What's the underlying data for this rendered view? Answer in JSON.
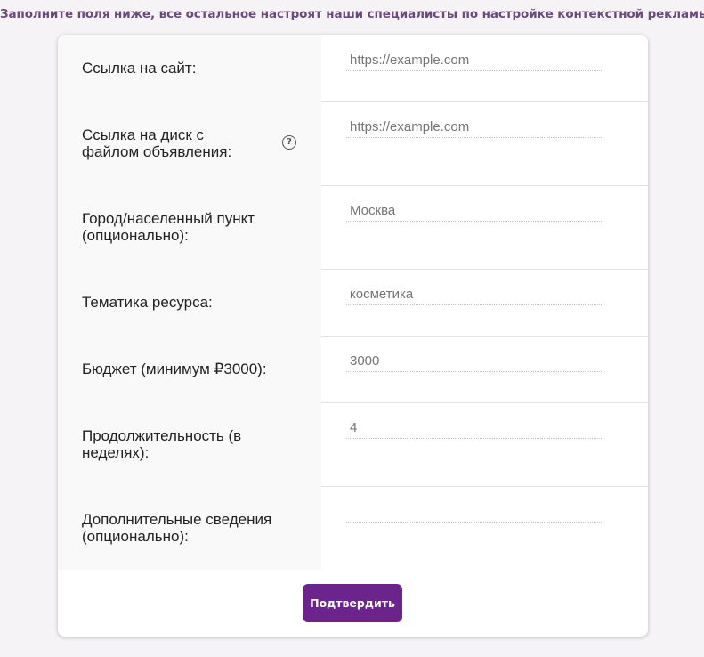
{
  "heading": "Заполните поля ниже, все остальное настроят наши специалисты по настройке контекстной рекламы",
  "form": {
    "fields": [
      {
        "label": "Ссылка на сайт:",
        "placeholder": "https://example.com",
        "value": ""
      },
      {
        "label": "Ссылка на диск с файлом объявления:",
        "placeholder": "https://example.com",
        "value": "",
        "help": "?"
      },
      {
        "label": "Город/населенный пункт (опционально):",
        "placeholder": "Москва",
        "value": ""
      },
      {
        "label": "Тематика ресурса:",
        "placeholder": "косметика",
        "value": ""
      },
      {
        "label": "Бюджет (минимум ₽3000):",
        "placeholder": "3000",
        "value": ""
      },
      {
        "label": "Продолжительность (в неделях):",
        "placeholder": "4",
        "value": ""
      },
      {
        "label": "Дополнительные сведения (опционально):",
        "placeholder": "",
        "value": ""
      }
    ],
    "submit_label": "Подтвердить"
  },
  "colors": {
    "accent": "#6c248d",
    "heading": "#6b4a7e",
    "background": "#f5f3f6"
  }
}
